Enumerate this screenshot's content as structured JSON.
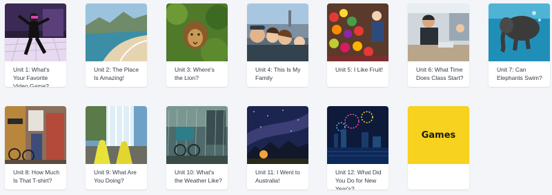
{
  "units": [
    {
      "label": "Unit 1: What's Your Favorite Video Game?"
    },
    {
      "label": "Unit 2: The Place Is Amazing!"
    },
    {
      "label": "Unit 3: Where's the Lion?"
    },
    {
      "label": "Unit 4: This Is My Family"
    },
    {
      "label": "Unit 5: I Like Fruit!"
    },
    {
      "label": "Unit 6: What Time Does Class Start?"
    },
    {
      "label": "Unit 7: Can Elephants Swim?"
    },
    {
      "label": "Unit 8: How Much Is That T-shirt?"
    },
    {
      "label": "Unit 9: What Are You Doing?"
    },
    {
      "label": "Unit 10: What's the Weather Like?"
    },
    {
      "label": "Unit 11: I Went to Australia!"
    },
    {
      "label": "Unit 12: What Did You Do for New Year's?"
    }
  ],
  "games": {
    "label": "Games",
    "color": "#f7d21e"
  },
  "colors": {
    "page_bg": "#f4f5f9",
    "card_bg": "#ffffff",
    "text": "#333a44"
  }
}
